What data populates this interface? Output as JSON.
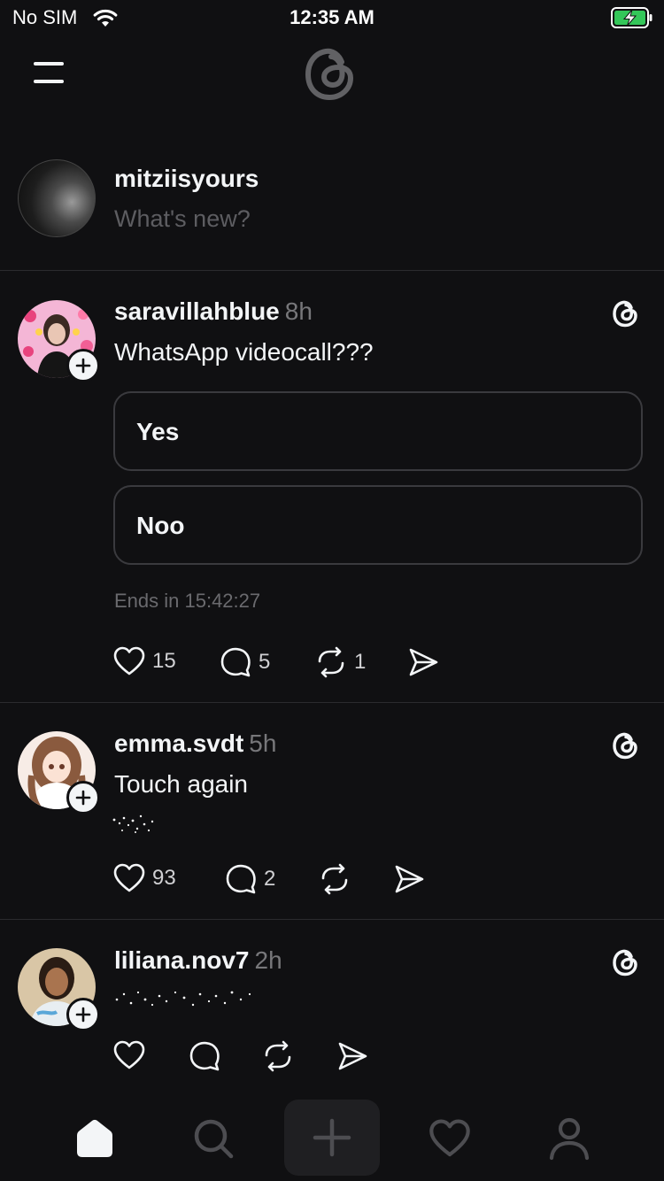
{
  "status": {
    "carrier": "No SIM",
    "time": "12:35 AM"
  },
  "composer": {
    "username": "mitziisyours",
    "placeholder": "What's new?"
  },
  "posts": [
    {
      "username": "saravillahblue",
      "time": "8h",
      "text": "WhatsApp videocall???",
      "poll": {
        "options": [
          "Yes",
          "Noo"
        ],
        "meta": "Ends in 15:42:27"
      },
      "likes": "15",
      "replies": "5",
      "reposts": "1"
    },
    {
      "username": "emma.svdt",
      "time": "5h",
      "text": "Touch again",
      "likes": "93",
      "replies": "2"
    },
    {
      "username": "liliana.nov7",
      "time": "2h"
    }
  ],
  "icons": {
    "menu": "hamburger-menu-icon",
    "logo": "threads-logo-icon",
    "like": "heart-outline-icon",
    "reply": "speech-bubble-icon",
    "repost": "repost-arrows-icon",
    "share": "send-arrow-icon",
    "home": "home-filled-icon",
    "search": "search-icon",
    "compose": "plus-icon",
    "activity": "heart-outline-icon",
    "profile": "person-outline-icon"
  },
  "colors": {
    "background": "#101012",
    "text": "#f3f5f7",
    "secondary_text": "#77777a",
    "divider": "#2b2b2e",
    "battery_fill": "#34c759"
  }
}
